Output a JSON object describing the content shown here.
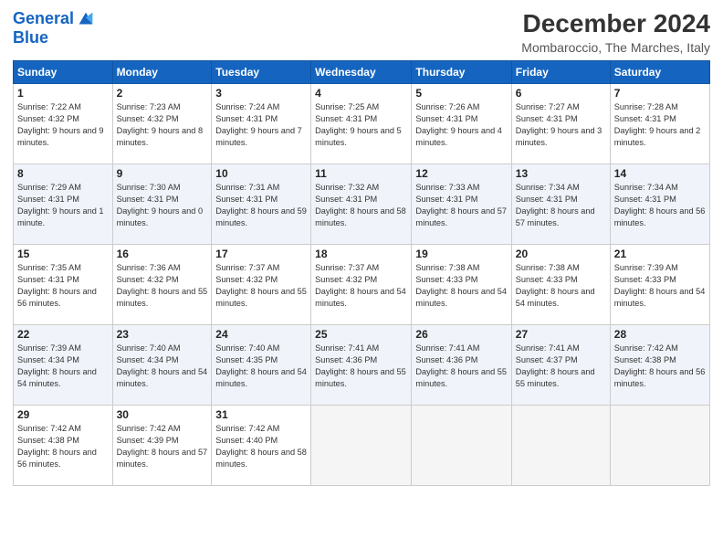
{
  "logo": {
    "line1": "General",
    "line2": "Blue"
  },
  "title": "December 2024",
  "subtitle": "Mombaroccio, The Marches, Italy",
  "days_header": [
    "Sunday",
    "Monday",
    "Tuesday",
    "Wednesday",
    "Thursday",
    "Friday",
    "Saturday"
  ],
  "weeks": [
    [
      {
        "day": "1",
        "sunrise": "7:22 AM",
        "sunset": "4:32 PM",
        "daylight": "9 hours and 9 minutes."
      },
      {
        "day": "2",
        "sunrise": "7:23 AM",
        "sunset": "4:32 PM",
        "daylight": "9 hours and 8 minutes."
      },
      {
        "day": "3",
        "sunrise": "7:24 AM",
        "sunset": "4:31 PM",
        "daylight": "9 hours and 7 minutes."
      },
      {
        "day": "4",
        "sunrise": "7:25 AM",
        "sunset": "4:31 PM",
        "daylight": "9 hours and 5 minutes."
      },
      {
        "day": "5",
        "sunrise": "7:26 AM",
        "sunset": "4:31 PM",
        "daylight": "9 hours and 4 minutes."
      },
      {
        "day": "6",
        "sunrise": "7:27 AM",
        "sunset": "4:31 PM",
        "daylight": "9 hours and 3 minutes."
      },
      {
        "day": "7",
        "sunrise": "7:28 AM",
        "sunset": "4:31 PM",
        "daylight": "9 hours and 2 minutes."
      }
    ],
    [
      {
        "day": "8",
        "sunrise": "7:29 AM",
        "sunset": "4:31 PM",
        "daylight": "9 hours and 1 minute."
      },
      {
        "day": "9",
        "sunrise": "7:30 AM",
        "sunset": "4:31 PM",
        "daylight": "9 hours and 0 minutes."
      },
      {
        "day": "10",
        "sunrise": "7:31 AM",
        "sunset": "4:31 PM",
        "daylight": "8 hours and 59 minutes."
      },
      {
        "day": "11",
        "sunrise": "7:32 AM",
        "sunset": "4:31 PM",
        "daylight": "8 hours and 58 minutes."
      },
      {
        "day": "12",
        "sunrise": "7:33 AM",
        "sunset": "4:31 PM",
        "daylight": "8 hours and 57 minutes."
      },
      {
        "day": "13",
        "sunrise": "7:34 AM",
        "sunset": "4:31 PM",
        "daylight": "8 hours and 57 minutes."
      },
      {
        "day": "14",
        "sunrise": "7:34 AM",
        "sunset": "4:31 PM",
        "daylight": "8 hours and 56 minutes."
      }
    ],
    [
      {
        "day": "15",
        "sunrise": "7:35 AM",
        "sunset": "4:31 PM",
        "daylight": "8 hours and 56 minutes."
      },
      {
        "day": "16",
        "sunrise": "7:36 AM",
        "sunset": "4:32 PM",
        "daylight": "8 hours and 55 minutes."
      },
      {
        "day": "17",
        "sunrise": "7:37 AM",
        "sunset": "4:32 PM",
        "daylight": "8 hours and 55 minutes."
      },
      {
        "day": "18",
        "sunrise": "7:37 AM",
        "sunset": "4:32 PM",
        "daylight": "8 hours and 54 minutes."
      },
      {
        "day": "19",
        "sunrise": "7:38 AM",
        "sunset": "4:33 PM",
        "daylight": "8 hours and 54 minutes."
      },
      {
        "day": "20",
        "sunrise": "7:38 AM",
        "sunset": "4:33 PM",
        "daylight": "8 hours and 54 minutes."
      },
      {
        "day": "21",
        "sunrise": "7:39 AM",
        "sunset": "4:33 PM",
        "daylight": "8 hours and 54 minutes."
      }
    ],
    [
      {
        "day": "22",
        "sunrise": "7:39 AM",
        "sunset": "4:34 PM",
        "daylight": "8 hours and 54 minutes."
      },
      {
        "day": "23",
        "sunrise": "7:40 AM",
        "sunset": "4:34 PM",
        "daylight": "8 hours and 54 minutes."
      },
      {
        "day": "24",
        "sunrise": "7:40 AM",
        "sunset": "4:35 PM",
        "daylight": "8 hours and 54 minutes."
      },
      {
        "day": "25",
        "sunrise": "7:41 AM",
        "sunset": "4:36 PM",
        "daylight": "8 hours and 55 minutes."
      },
      {
        "day": "26",
        "sunrise": "7:41 AM",
        "sunset": "4:36 PM",
        "daylight": "8 hours and 55 minutes."
      },
      {
        "day": "27",
        "sunrise": "7:41 AM",
        "sunset": "4:37 PM",
        "daylight": "8 hours and 55 minutes."
      },
      {
        "day": "28",
        "sunrise": "7:42 AM",
        "sunset": "4:38 PM",
        "daylight": "8 hours and 56 minutes."
      }
    ],
    [
      {
        "day": "29",
        "sunrise": "7:42 AM",
        "sunset": "4:38 PM",
        "daylight": "8 hours and 56 minutes."
      },
      {
        "day": "30",
        "sunrise": "7:42 AM",
        "sunset": "4:39 PM",
        "daylight": "8 hours and 57 minutes."
      },
      {
        "day": "31",
        "sunrise": "7:42 AM",
        "sunset": "4:40 PM",
        "daylight": "8 hours and 58 minutes."
      },
      null,
      null,
      null,
      null
    ]
  ]
}
